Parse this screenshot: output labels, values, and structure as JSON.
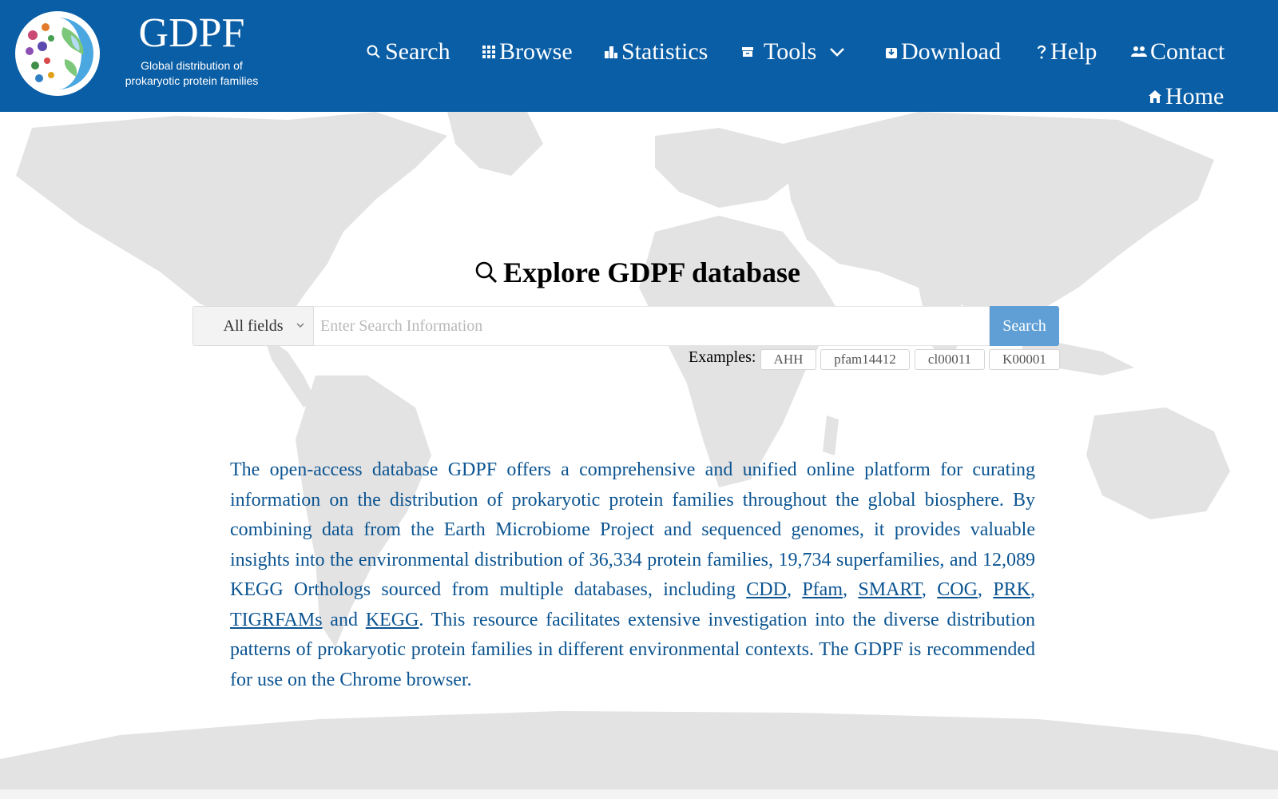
{
  "brand": {
    "title": "GDPF",
    "subtitle_line1": "Global distribution of",
    "subtitle_line2": "prokaryotic protein families"
  },
  "nav": {
    "search": "Search",
    "browse": "Browse",
    "statistics": "Statistics",
    "tools": "Tools",
    "download": "Download",
    "help": "Help",
    "contact": "Contact",
    "home": "Home"
  },
  "search": {
    "title": "Explore GDPF database",
    "field_selected": "All fields",
    "placeholder": "Enter Search Information",
    "button": "Search",
    "examples_label": "Examples:",
    "examples": [
      "AHH",
      "pfam14412",
      "cl00011",
      "K00001"
    ]
  },
  "description": {
    "text1": "The open-access database GDPF offers a comprehensive and unified online platform for curating information on the distribution of prokaryotic protein families throughout the global biosphere. By combining data from the Earth Microbiome Project and sequenced genomes, it provides valuable insights into the environmental distribution of 36,334 protein families, 19,734 superfamilies, and 12,089 KEGG Orthologs sourced from multiple databases, including ",
    "links": [
      "CDD",
      "Pfam",
      "SMART",
      "COG",
      "PRK",
      "TIGRFAMs",
      "KEGG"
    ],
    "sep_comma": ", ",
    "sep_and": " and ",
    "text2": ". This resource facilitates extensive investigation into the diverse distribution patterns of prokaryotic protein families in different environmental contexts. The GDPF is recommended for use on the Chrome browser."
  },
  "colors": {
    "header_bg": "#0a5ea6",
    "description_text": "#0b5491",
    "search_button": "#5f9fd6",
    "map_land": "#e3e3e3"
  },
  "icons": {
    "search": "magnifier-icon",
    "browse": "grid-icon",
    "statistics": "bar-chart-icon",
    "tools": "archive-box-icon",
    "download": "download-icon",
    "help": "question-icon",
    "contact": "people-icon",
    "home": "house-icon"
  }
}
